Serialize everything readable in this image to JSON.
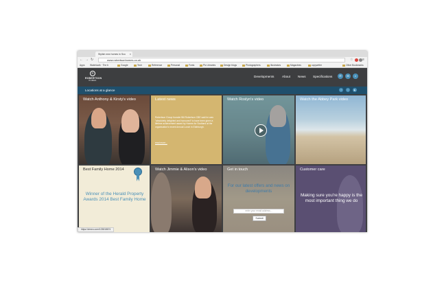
{
  "browser": {
    "tab_title": "Stylish new homes in Sco",
    "url": "www.robertsonhomes.co.uk",
    "status_url": "https://vimeo.com/123818674",
    "bookmarks": [
      "Apps",
      "Watertoolk · The b",
      "Google",
      "Tech",
      "Reference",
      "Personal",
      "Fonts",
      "Pic Libraries",
      "Design blogs",
      "Photographers",
      "Illustrators",
      "Magazines",
      "copywriter",
      "Other Bookmarks"
    ]
  },
  "site": {
    "logo_name": "ROBERTSON",
    "logo_sub": "HOMES",
    "nav": [
      "Developments",
      "About",
      "News",
      "Specifications"
    ],
    "locations": "Locations at a glance"
  },
  "tiles": {
    "video1": "Watch Anthony & Kirsty's video",
    "news_title": "Latest news",
    "news_body": "Robertson Group founder Bill Robertson CBE said he was \"absolutely delighted and honoured\" to have been given a lifetime achievement award by Homes for Scotland at the organisation's recent Annual Lunch in Edinburgh.",
    "news_more": "read more...",
    "video2": "Watch Roslyn's video",
    "video3": "Watch the Abbey Park video",
    "award_title": "Best Family Home 2014",
    "award_text": "Winner of the Herald Property Awards 2014 Best Family Home",
    "video4": "Watch Jimmie & Alison's video",
    "touch_title": "Get in touch",
    "touch_text": "For our latest offers and news on developments",
    "email_placeholder": "enter your email address...",
    "submit": "Submit",
    "care_title": "Customer care",
    "care_text": "Making sure you're happy is the most important thing we do"
  },
  "colors": {
    "accent": "#4a90b8",
    "header": "#3d3e40",
    "locbar": "#1f4f6c",
    "news": "#d4b670"
  }
}
